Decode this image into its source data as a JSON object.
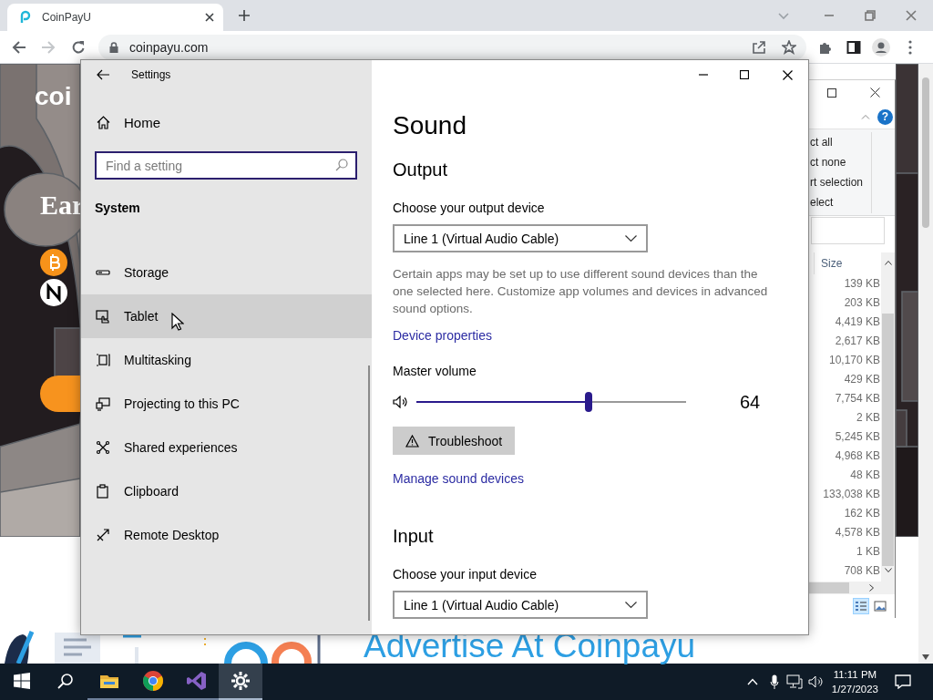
{
  "browser": {
    "tab_title": "CoinPayU",
    "address": "coinpayu.com",
    "forward_enabled": false
  },
  "web_page": {
    "logo_text": "coi",
    "heading": "Ear",
    "banner_text": "Advertise At Coinpayu"
  },
  "explorer": {
    "ribbon_items": [
      "ct all",
      "ct none",
      "rt selection",
      "elect"
    ],
    "help_button": "?",
    "column": "Size",
    "sizes": [
      "139 KB",
      "203 KB",
      "4,419 KB",
      "2,617 KB",
      "10,170 KB",
      "429 KB",
      "7,754 KB",
      "2 KB",
      "5,245 KB",
      "4,968 KB",
      "48 KB",
      "133,038 KB",
      "162 KB",
      "4,578 KB",
      "1 KB",
      "708 KB"
    ],
    "views": [
      {
        "kind": "details",
        "selected": true
      },
      {
        "kind": "large_icons",
        "selected": false
      }
    ]
  },
  "settings": {
    "title": "Settings",
    "home": "Home",
    "search": {
      "placeholder": "Find a setting"
    },
    "section": "System",
    "nav": [
      {
        "kind": "storage",
        "label": "Storage",
        "hovered": false
      },
      {
        "kind": "tablet",
        "label": "Tablet",
        "hovered": true
      },
      {
        "kind": "multitasking",
        "label": "Multitasking",
        "hovered": false
      },
      {
        "kind": "projecting",
        "label": "Projecting to this PC",
        "hovered": false
      },
      {
        "kind": "shared",
        "label": "Shared experiences",
        "hovered": false
      },
      {
        "kind": "clipboard",
        "label": "Clipboard",
        "hovered": false
      },
      {
        "kind": "remote",
        "label": "Remote Desktop",
        "hovered": false
      }
    ],
    "page_title": "Sound",
    "output": {
      "heading": "Output",
      "device_label": "Choose your output device",
      "device": "Line 1 (Virtual Audio Cable)",
      "note": "Certain apps may be set up to use different sound devices than the one selected here. Customize app volumes and devices in advanced sound options.",
      "properties_link": "Device properties"
    },
    "volume": {
      "label": "Master volume",
      "level": 0.64,
      "reading": "64"
    },
    "troubleshoot": "Troubleshoot",
    "manage_link": "Manage sound devices",
    "input": {
      "heading": "Input",
      "device_label": "Choose your input device",
      "device": "Line 1 (Virtual Audio Cable)"
    }
  },
  "taskbar": {
    "apps": [
      {
        "kind": "explorer",
        "running": true,
        "selected": false
      },
      {
        "kind": "chrome",
        "running": true,
        "selected": false
      },
      {
        "kind": "studio",
        "running": true,
        "selected": false
      },
      {
        "kind": "settings",
        "running": true,
        "selected": true
      }
    ],
    "time": "11:11 PM",
    "date": "1/27/2023"
  }
}
